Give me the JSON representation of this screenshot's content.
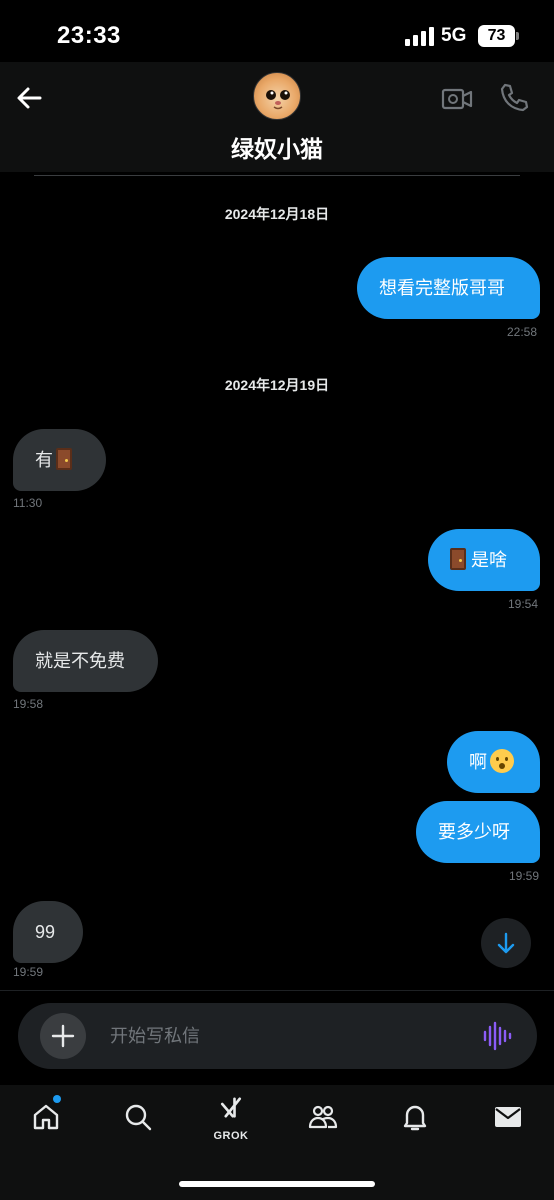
{
  "status_bar": {
    "time": "23:33",
    "network": "5G",
    "battery": "73"
  },
  "header": {
    "contact_name": "绿奴小猫"
  },
  "messages": [
    {
      "type": "date",
      "text": "2024年12月18日"
    },
    {
      "type": "out",
      "text": "想看完整版哥哥",
      "time": "22:58"
    },
    {
      "type": "date",
      "text": "2024年12月19日"
    },
    {
      "type": "in",
      "text": "有",
      "emoji": "door",
      "time": "11:30"
    },
    {
      "type": "out",
      "text": "是啥",
      "emoji": "door",
      "time": "19:54"
    },
    {
      "type": "in",
      "text": "就是不免费",
      "time": "19:58"
    },
    {
      "type": "out",
      "text": "啊",
      "emoji": "anxious-face"
    },
    {
      "type": "out",
      "text": "要多少呀",
      "time": "19:59"
    },
    {
      "type": "in",
      "text": "99",
      "time": "19:59"
    }
  ],
  "composer": {
    "placeholder": "开始写私信"
  },
  "tabbar": {
    "grok_label": "GROK"
  },
  "icons": {
    "back": "back-arrow-icon",
    "video": "video-camera-icon",
    "call": "phone-icon",
    "plus": "plus-icon",
    "voice": "voice-waveform-icon",
    "scroll": "arrow-down-icon",
    "home": "home-icon",
    "search": "search-icon",
    "grok": "grok-icon",
    "communities": "communities-icon",
    "notifications": "bell-icon",
    "messages": "mail-icon"
  },
  "colors": {
    "accent": "#1d9bf0",
    "incoming_bubble": "#2f3336",
    "background": "#000000",
    "voice": "#8b5cf6"
  }
}
